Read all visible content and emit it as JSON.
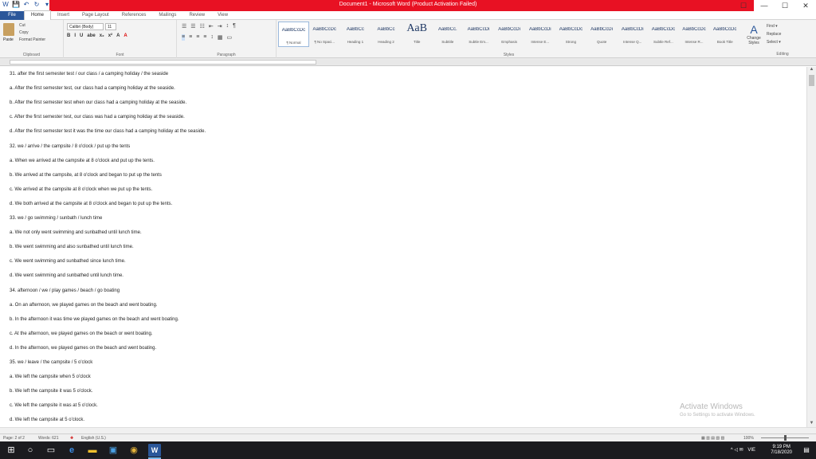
{
  "window": {
    "title": "Document1 - Microsoft Word (Product Activation Failed)",
    "min_glyph": "—",
    "max_glyph": "☐",
    "close_glyph": "✕",
    "ribbon_opts_glyph": "☐"
  },
  "qat": {
    "word_glyph": "W",
    "save_glyph": "💾",
    "undo_glyph": "↶",
    "redo_glyph": "↻",
    "customize_glyph": "▾"
  },
  "tabs": [
    "File",
    "Home",
    "Insert",
    "Page Layout",
    "References",
    "Mailings",
    "Review",
    "View"
  ],
  "ribbon": {
    "clipboard": {
      "paste_label": "Paste",
      "items": [
        "Cut",
        "Copy",
        "Format Painter"
      ],
      "label": "Clipboard"
    },
    "font": {
      "name": "Calibri (Body)",
      "size": "11",
      "buttons": [
        "B",
        "I",
        "U",
        "abe",
        "x₂",
        "x²",
        "A",
        "A"
      ],
      "label": "Font"
    },
    "paragraph": {
      "row1": [
        "☰",
        "☰",
        "☷",
        "⇤",
        "⇥",
        "↕",
        "¶"
      ],
      "row2": [
        "≡",
        "≡",
        "≡",
        "≡",
        "↕",
        "▦",
        "▭"
      ],
      "label": "Paragraph"
    },
    "styles": {
      "tiles": [
        {
          "sample": "AaBbCcDc",
          "name": "¶ Normal"
        },
        {
          "sample": "AaBbCcDc",
          "name": "¶ No Spaci..."
        },
        {
          "sample": "AaBbCc",
          "name": "Heading 1"
        },
        {
          "sample": "AaBbCc",
          "name": "Heading 2"
        },
        {
          "sample": "AaB",
          "name": "Title"
        },
        {
          "sample": "AaBbCc.",
          "name": "Subtitle"
        },
        {
          "sample": "AaBbCcDi",
          "name": "Subtle Em..."
        },
        {
          "sample": "AaBbCcDi",
          "name": "Emphasis"
        },
        {
          "sample": "AaBbCcDi",
          "name": "Intense E..."
        },
        {
          "sample": "AaBbCcDc",
          "name": "Strong"
        },
        {
          "sample": "AaBbCcDi",
          "name": "Quote"
        },
        {
          "sample": "AaBbCcDi",
          "name": "Intense Q..."
        },
        {
          "sample": "AaBbCcDc",
          "name": "Subtle Ref..."
        },
        {
          "sample": "AaBbCcDc",
          "name": "Intense R..."
        },
        {
          "sample": "AaBbCcDc",
          "name": "Book Title"
        }
      ],
      "change_styles": "Change Styles",
      "label": "Styles"
    },
    "editing": {
      "items": [
        "Find ▾",
        "Replace",
        "Select ▾"
      ],
      "label": "Editing"
    }
  },
  "document": {
    "lines": [
      "31. after the first semester test / our class / a camping holiday / the seaside",
      "a. After the first semester test, our class had a camping holiday at the seaside.",
      "b. After the first semester test when our class had a camping holiday at the seaside.",
      "c. After the first semester test, our class was had a camping holiday at the seaside.",
      "d. After the first semester test it was the time our class had a camping holiday at the seaside.",
      "32. we / arrive / the campsite / 8 o'clock / put up the tents",
      "a. When we arrived at the campsite at 8 o'clock and put up the tents.",
      "b. We arrived at the campsite, at 8 o'clock and began to put up the tents",
      "c. We arrived at the campsite at 8 o'clock when we put up the tents.",
      "d. We both arrived at the campsite at 8 o'clock and began to put up the tents.",
      "33. we / go swimming / sunbath / lunch time",
      "a. We not only went swimming and sunbathed until lunch time.",
      "b. We went swimming and also sunbathed until lunch time.",
      "c. We went swimming and sunbathed since lunch time.",
      "d. We went swimming and sunbathed until lunch time.",
      "34. afternoon / we / play games / beach / go boating",
      "a. On an afternoon, we played games on the beach and went boating.",
      "b. In the afternoon it was time we played games on the beach and went boating.",
      "c. At the afternoon, we played games on the beach or went boating.",
      "d. In the afternoon, we played games on the beach and went boating.",
      "35. we / leave / the campsite / 5 o'clock",
      "a. We left the campsite when 5 o'clock",
      "b. We left the campsite it was 5 o'clock.",
      "c. We left the campsite it was at 5 o'clock.",
      "d. We left the campsite at 5 o'clock."
    ]
  },
  "activation": {
    "title": "Activate Windows",
    "subtitle": "Go to Settings to activate Windows."
  },
  "statusbar": {
    "page": "Page: 2 of 2",
    "words": "Words: 621",
    "language": "English (U.S.)",
    "zoom": "100%"
  },
  "taskbar": {
    "time": "9:19 PM",
    "date": "7/18/2020",
    "lang": "VIE",
    "start_glyph": "⊞",
    "search_glyph": "○",
    "taskview_glyph": "▭",
    "edge_glyph": "e",
    "explorer_glyph": "▬",
    "store_glyph": "▣",
    "chrome_glyph": "◉",
    "word_glyph": "W",
    "tray_glyph": "^ ◁ ✉",
    "notify_glyph": "▤"
  }
}
